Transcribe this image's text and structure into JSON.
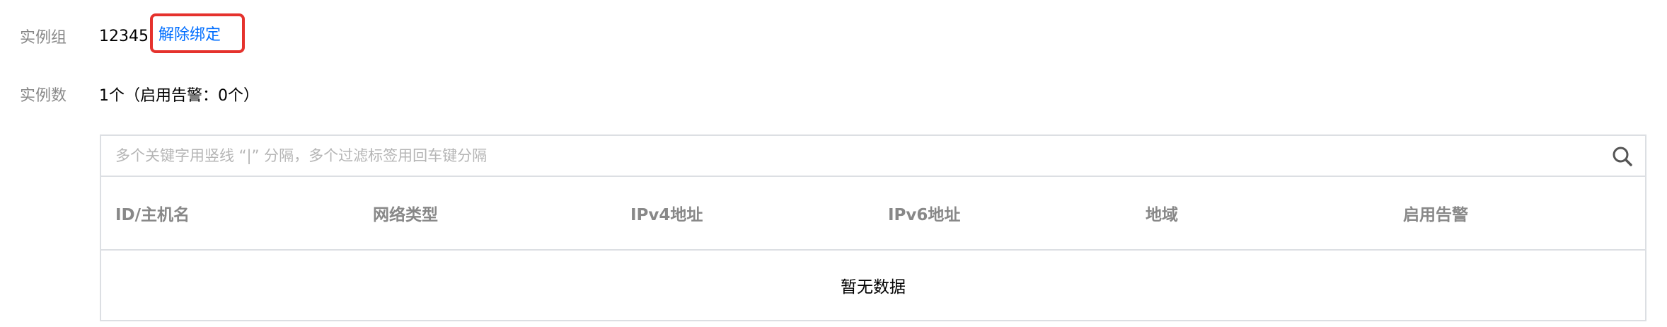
{
  "instance_group": {
    "label": "实例组",
    "value": "12345",
    "unbind_label": "解除绑定"
  },
  "instance_count": {
    "label": "实例数",
    "value": "1个（启用告警：0个）"
  },
  "search": {
    "placeholder": "多个关键字用竖线 “|” 分隔，多个过滤标签用回车键分隔",
    "value": ""
  },
  "table": {
    "columns": [
      "ID/主机名",
      "网络类型",
      "IPv4地址",
      "IPv6地址",
      "地域",
      "启用告警"
    ],
    "rows": [],
    "empty_text": "暂无数据"
  },
  "colors": {
    "link": "#006eff",
    "highlight_box": "#e5322d",
    "border": "#dcdfe3",
    "label": "#888888"
  },
  "icons": {
    "search": "search-icon"
  }
}
